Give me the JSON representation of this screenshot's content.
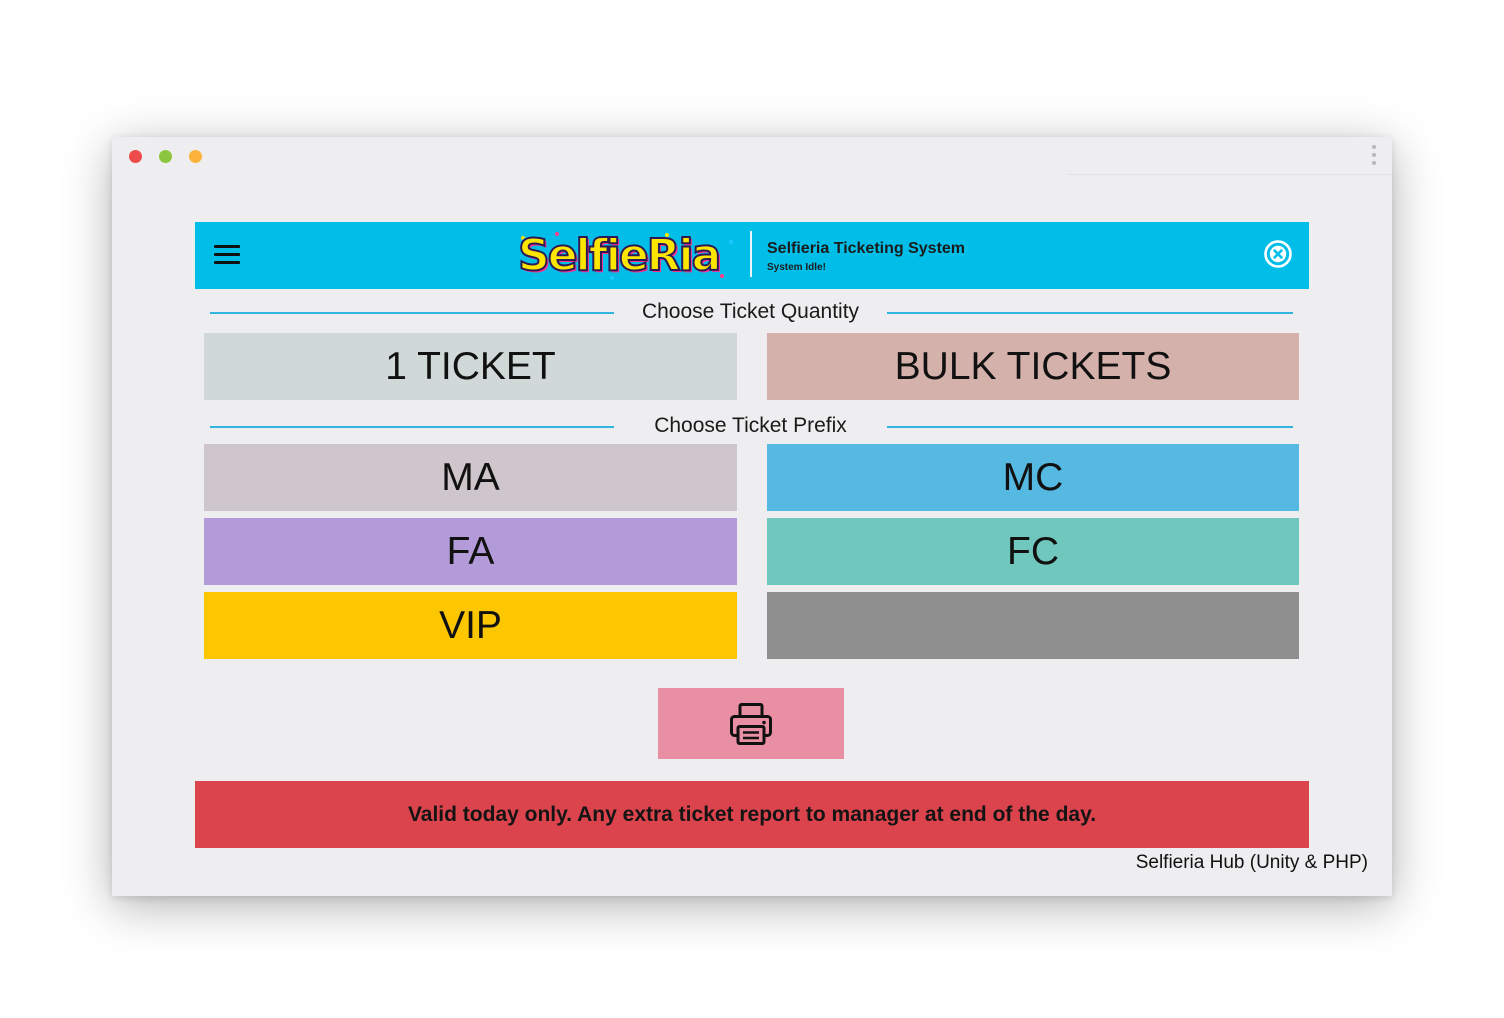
{
  "window": {
    "traffic_lights": [
      {
        "name": "close",
        "color": "#ee4c4c"
      },
      {
        "name": "minimize",
        "color": "#8cc63f"
      },
      {
        "name": "zoom",
        "color": "#fbb33c"
      }
    ],
    "more_icon": "vertical-ellipsis"
  },
  "header": {
    "background": "#00bee8",
    "menu_icon": "hamburger-menu",
    "logo_text": "SelfieRia",
    "title": "Selfieria Ticketing System",
    "status": "System Idle!",
    "close_icon": "circle-x"
  },
  "quantity": {
    "label": "Choose Ticket Quantity",
    "options": [
      {
        "label": "1 TICKET",
        "color": "#d0d8d8"
      },
      {
        "label": "BULK TICKETS",
        "color": "#d4b2ab"
      }
    ]
  },
  "prefix": {
    "label": "Choose Ticket Prefix",
    "options": [
      {
        "label": "MA",
        "color": "#cfc6cc"
      },
      {
        "label": "MC",
        "color": "#55b9e2"
      },
      {
        "label": "FA",
        "color": "#b39ad9"
      },
      {
        "label": "FC",
        "color": "#70c7bd"
      },
      {
        "label": "VIP",
        "color": "#fcc600"
      },
      {
        "label": "",
        "color": "#8f8f8f"
      }
    ]
  },
  "print_button": {
    "icon": "printer-icon",
    "color": "#e88fa3"
  },
  "notice": {
    "text": "Valid today only. Any extra ticket report to manager at end of the day.",
    "color": "#db444c"
  },
  "footer": {
    "text": "Selfieria Hub (Unity & PHP)"
  }
}
